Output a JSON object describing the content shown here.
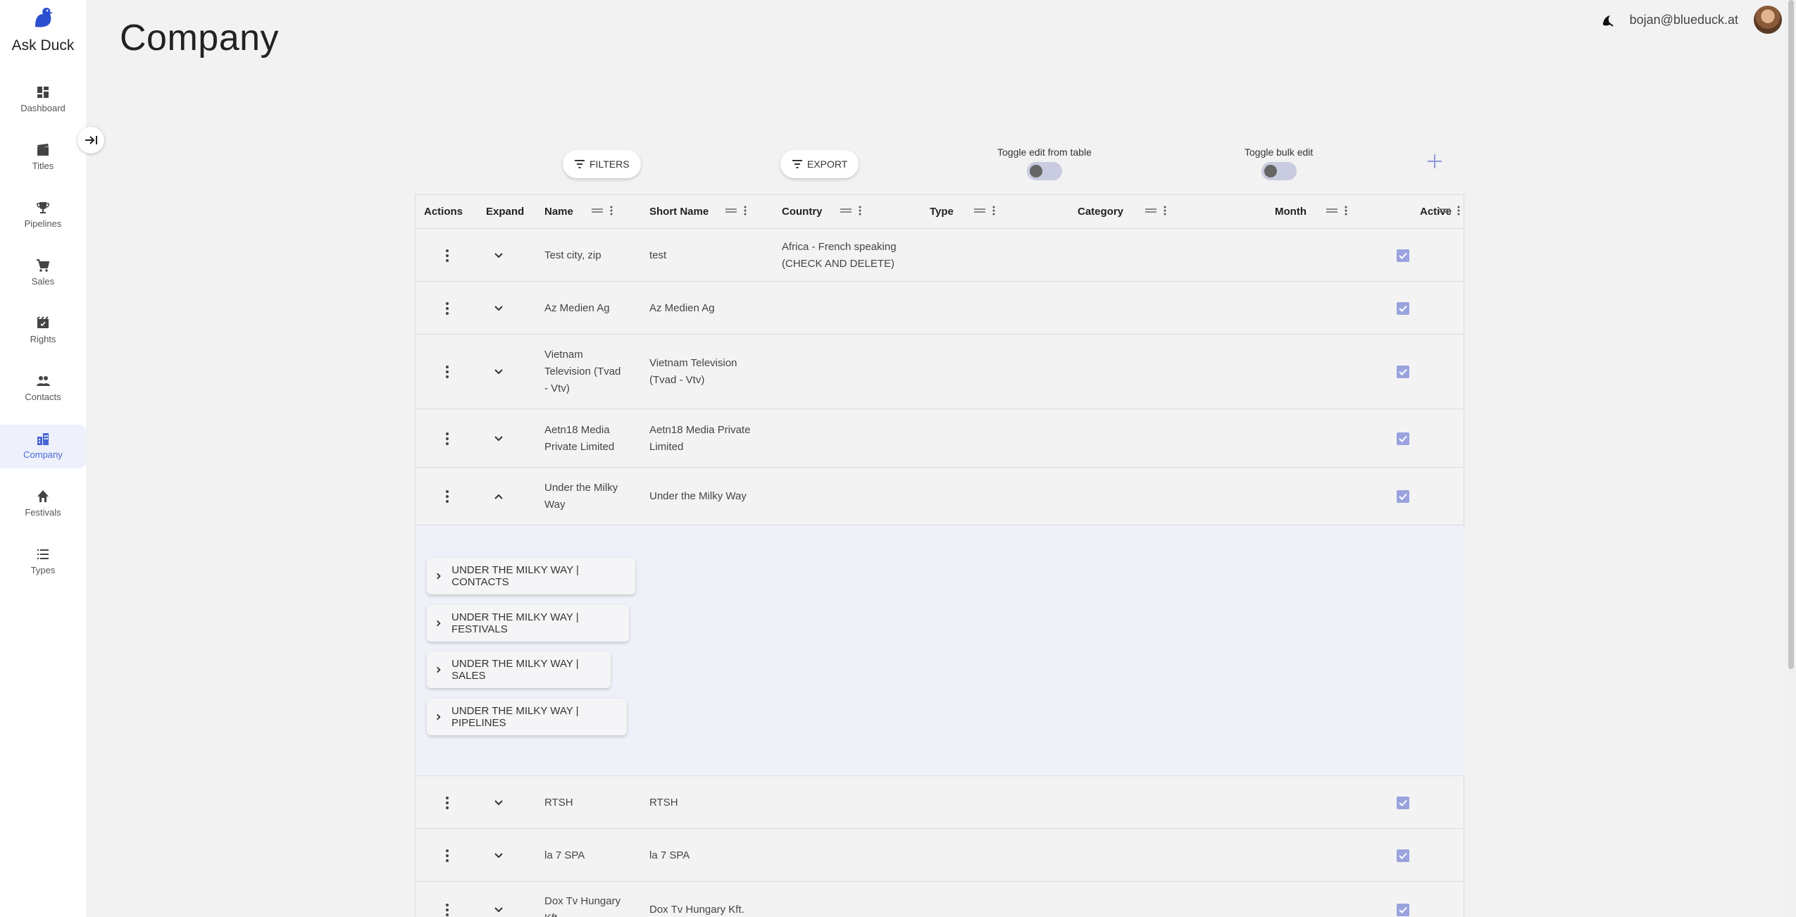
{
  "app": {
    "name": "Ask Duck"
  },
  "sidebar": {
    "items": [
      {
        "label": "Dashboard",
        "icon": "dashboard-icon"
      },
      {
        "label": "Titles",
        "icon": "clapperboard-icon"
      },
      {
        "label": "Pipelines",
        "icon": "trophy-icon"
      },
      {
        "label": "Sales",
        "icon": "cart-icon"
      },
      {
        "label": "Rights",
        "icon": "rights-icon"
      },
      {
        "label": "Contacts",
        "icon": "people-icon"
      },
      {
        "label": "Company",
        "icon": "buildings-icon",
        "active": true
      },
      {
        "label": "Festivals",
        "icon": "festival-icon"
      },
      {
        "label": "Types",
        "icon": "list-icon"
      }
    ]
  },
  "header": {
    "title": "Company",
    "user_email": "bojan@blueduck.at"
  },
  "toolbar": {
    "filters_label": "FILTERS",
    "export_label": "EXPORT",
    "toggle_edit_label": "Toggle edit from table",
    "toggle_bulk_label": "Toggle bulk edit",
    "toggle_edit_on": false,
    "toggle_bulk_on": false
  },
  "table": {
    "columns": [
      "Actions",
      "Expand",
      "Name",
      "Short Name",
      "Country",
      "Type",
      "Category",
      "Month",
      "Active"
    ],
    "rows": [
      {
        "name": [
          "Test city, zip"
        ],
        "short_name": [
          "test"
        ],
        "country": [
          "Africa - French speaking",
          "(CHECK AND DELETE)"
        ],
        "active": true,
        "expanded": false
      },
      {
        "name": [
          "Az Medien Ag"
        ],
        "short_name": [
          "Az Medien Ag"
        ],
        "country": [],
        "active": true,
        "expanded": false
      },
      {
        "name": [
          "Vietnam",
          "Television (Tvad",
          "- Vtv)"
        ],
        "short_name": [
          "Vietnam Television",
          "(Tvad - Vtv)"
        ],
        "country": [],
        "active": true,
        "expanded": false
      },
      {
        "name": [
          "Aetn18 Media",
          "Private Limited"
        ],
        "short_name": [
          "Aetn18 Media Private",
          "Limited"
        ],
        "country": [],
        "active": true,
        "expanded": false
      },
      {
        "name": [
          "Under the Milky",
          "Way"
        ],
        "short_name": [
          "Under the Milky Way"
        ],
        "country": [],
        "active": true,
        "expanded": true
      },
      {
        "name": [
          "RTSH"
        ],
        "short_name": [
          "RTSH"
        ],
        "country": [],
        "active": true,
        "expanded": false
      },
      {
        "name": [
          "la 7 SPA"
        ],
        "short_name": [
          "la 7 SPA"
        ],
        "country": [],
        "active": true,
        "expanded": false
      },
      {
        "name": [
          "Dox Tv Hungary",
          "Kft."
        ],
        "short_name": [
          "Dox Tv Hungary Kft."
        ],
        "country": [],
        "active": true,
        "expanded": false
      }
    ],
    "expanded_sections": [
      "UNDER THE MILKY WAY | CONTACTS",
      "UNDER THE MILKY WAY | FESTIVALS",
      "UNDER THE MILKY WAY | SALES",
      "UNDER THE MILKY WAY | PIPELINES"
    ]
  },
  "colors": {
    "accent": "#4a67d6",
    "checkbox": "#9aa3dd",
    "expand_bg": "#eef1f7"
  }
}
